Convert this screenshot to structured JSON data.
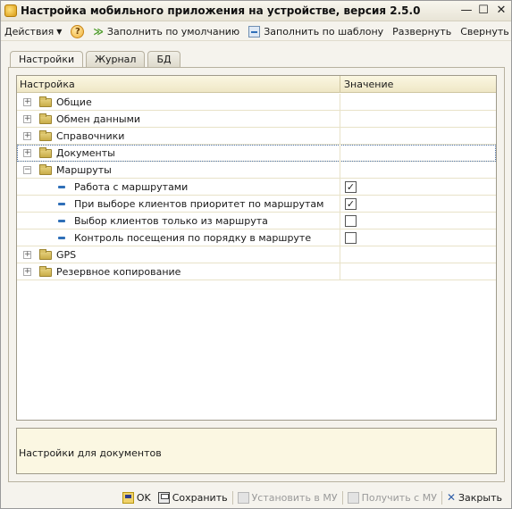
{
  "window": {
    "title": "Настройка мобильного приложения на устройстве, версия 2.5.0",
    "minimize_glyph": "—",
    "maximize_glyph": "☐",
    "close_glyph": "✕"
  },
  "toolbar": {
    "actions_label": "Действия",
    "help_glyph": "?",
    "fill_default_label": "Заполнить по умолчанию",
    "fill_template_label": "Заполнить по шаблону",
    "expand_label": "Развернуть",
    "collapse_label": "Свернуть"
  },
  "tabs": [
    {
      "label": "Настройки",
      "active": true
    },
    {
      "label": "Журнал",
      "active": false
    },
    {
      "label": "БД",
      "active": false
    }
  ],
  "tree": {
    "columns": [
      "Настройка",
      "Значение"
    ],
    "rows": [
      {
        "label": "Общие",
        "type": "group",
        "expanded": false,
        "level": 0
      },
      {
        "label": "Обмен данными",
        "type": "group",
        "expanded": false,
        "level": 0
      },
      {
        "label": "Справочники",
        "type": "group",
        "expanded": false,
        "level": 0
      },
      {
        "label": "Документы",
        "type": "group",
        "expanded": false,
        "level": 0,
        "focused": true
      },
      {
        "label": "Маршруты",
        "type": "group",
        "expanded": true,
        "level": 0
      },
      {
        "label": "Работа с маршрутами",
        "type": "setting",
        "level": 1,
        "checked": true
      },
      {
        "label": "При выборе клиентов приоритет по маршрутам",
        "type": "setting",
        "level": 1,
        "checked": true
      },
      {
        "label": "Выбор клиентов только из маршрута",
        "type": "setting",
        "level": 1,
        "checked": false
      },
      {
        "label": "Контроль посещения по порядку в маршруте",
        "type": "setting",
        "level": 1,
        "checked": false
      },
      {
        "label": "GPS",
        "type": "group",
        "expanded": false,
        "level": 0
      },
      {
        "label": "Резервное копирование",
        "type": "group",
        "expanded": false,
        "level": 0
      }
    ]
  },
  "description": "Настройки для документов",
  "bottombar": {
    "ok_label": "OK",
    "save_label": "Сохранить",
    "set_mu_label": "Установить в МУ",
    "get_mu_label": "Получить с МУ",
    "close_label": "Закрыть"
  }
}
